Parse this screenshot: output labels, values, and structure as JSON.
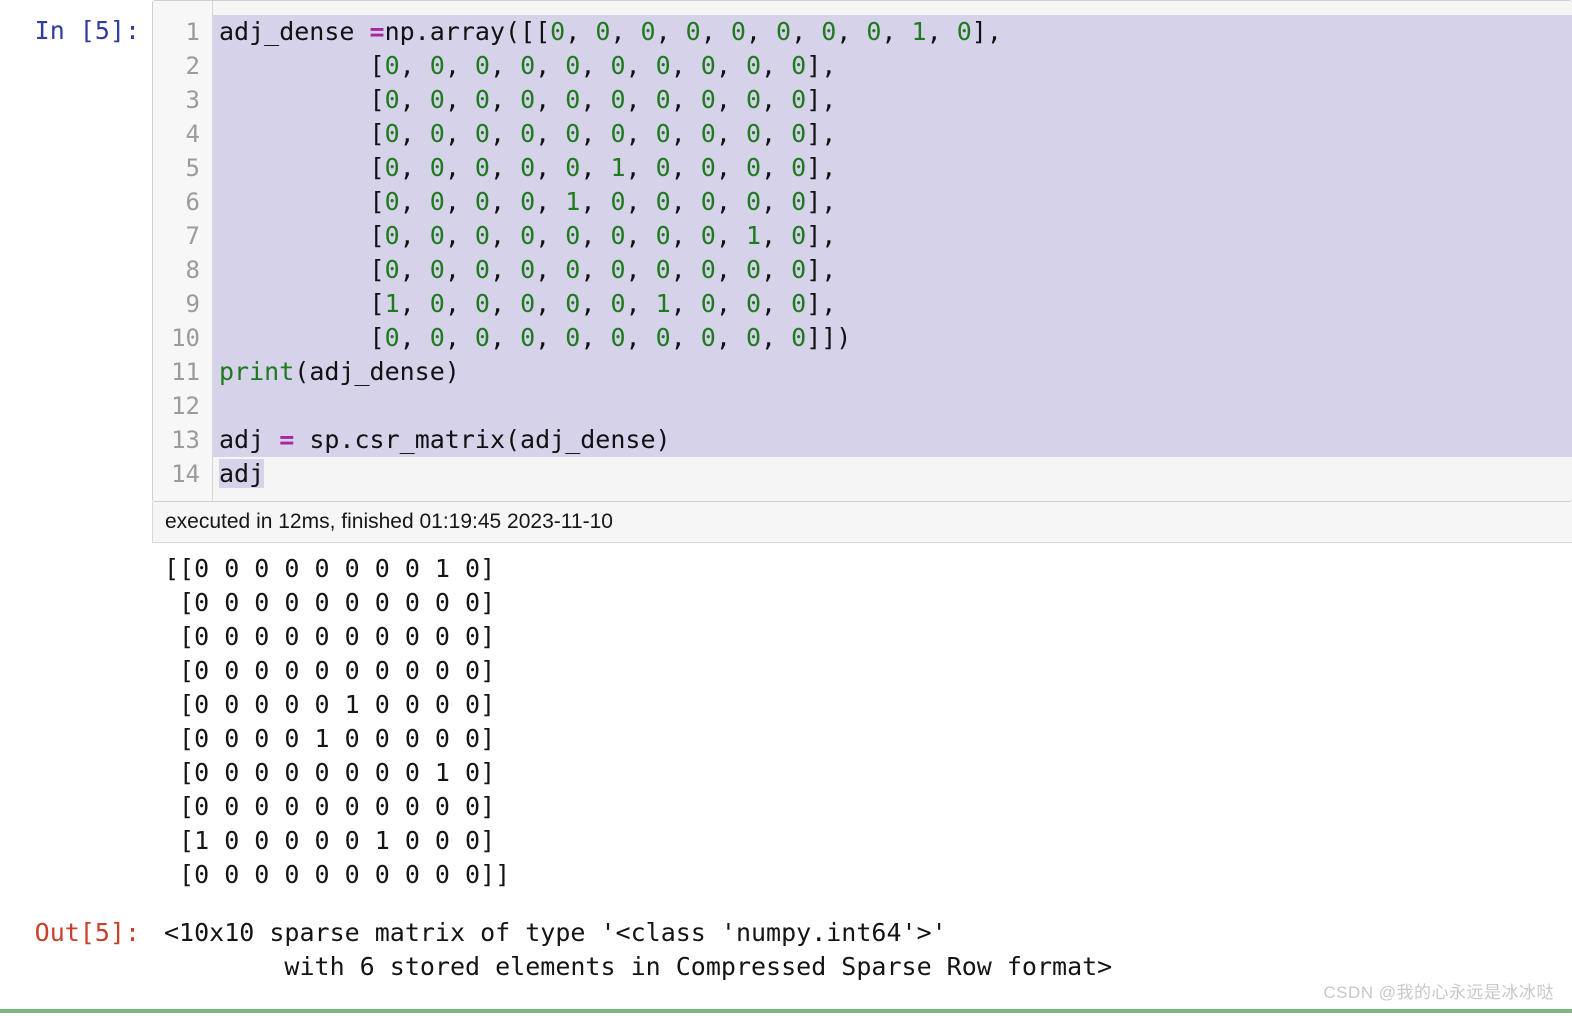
{
  "cell": {
    "in_prompt": "In [5]:",
    "out_prompt": "Out[5]:",
    "execution_info": "executed in 12ms, finished 01:19:45 2023-11-10",
    "line_numbers": [
      "1",
      "2",
      "3",
      "4",
      "5",
      "6",
      "7",
      "8",
      "9",
      "10",
      "11",
      "12",
      "13",
      "14"
    ],
    "code_lines": [
      {
        "n": 1,
        "selected": "full",
        "tokens": [
          {
            "t": "adj_dense ",
            "c": "pln"
          },
          {
            "t": "=",
            "c": "op"
          },
          {
            "t": "np.array([[",
            "c": "pln"
          },
          {
            "t": "0",
            "c": "num"
          },
          {
            "t": ", ",
            "c": "pln"
          },
          {
            "t": "0",
            "c": "num"
          },
          {
            "t": ", ",
            "c": "pln"
          },
          {
            "t": "0",
            "c": "num"
          },
          {
            "t": ", ",
            "c": "pln"
          },
          {
            "t": "0",
            "c": "num"
          },
          {
            "t": ", ",
            "c": "pln"
          },
          {
            "t": "0",
            "c": "num"
          },
          {
            "t": ", ",
            "c": "pln"
          },
          {
            "t": "0",
            "c": "num"
          },
          {
            "t": ", ",
            "c": "pln"
          },
          {
            "t": "0",
            "c": "num"
          },
          {
            "t": ", ",
            "c": "pln"
          },
          {
            "t": "0",
            "c": "num"
          },
          {
            "t": ", ",
            "c": "pln"
          },
          {
            "t": "1",
            "c": "num"
          },
          {
            "t": ", ",
            "c": "pln"
          },
          {
            "t": "0",
            "c": "num"
          },
          {
            "t": "],",
            "c": "pln"
          }
        ]
      },
      {
        "n": 2,
        "selected": "full",
        "tokens": [
          {
            "t": "          [",
            "c": "pln"
          },
          {
            "t": "0",
            "c": "num"
          },
          {
            "t": ", ",
            "c": "pln"
          },
          {
            "t": "0",
            "c": "num"
          },
          {
            "t": ", ",
            "c": "pln"
          },
          {
            "t": "0",
            "c": "num"
          },
          {
            "t": ", ",
            "c": "pln"
          },
          {
            "t": "0",
            "c": "num"
          },
          {
            "t": ", ",
            "c": "pln"
          },
          {
            "t": "0",
            "c": "num"
          },
          {
            "t": ", ",
            "c": "pln"
          },
          {
            "t": "0",
            "c": "num"
          },
          {
            "t": ", ",
            "c": "pln"
          },
          {
            "t": "0",
            "c": "num"
          },
          {
            "t": ", ",
            "c": "pln"
          },
          {
            "t": "0",
            "c": "num"
          },
          {
            "t": ", ",
            "c": "pln"
          },
          {
            "t": "0",
            "c": "num"
          },
          {
            "t": ", ",
            "c": "pln"
          },
          {
            "t": "0",
            "c": "num"
          },
          {
            "t": "],",
            "c": "pln"
          }
        ]
      },
      {
        "n": 3,
        "selected": "full",
        "tokens": [
          {
            "t": "          [",
            "c": "pln"
          },
          {
            "t": "0",
            "c": "num"
          },
          {
            "t": ", ",
            "c": "pln"
          },
          {
            "t": "0",
            "c": "num"
          },
          {
            "t": ", ",
            "c": "pln"
          },
          {
            "t": "0",
            "c": "num"
          },
          {
            "t": ", ",
            "c": "pln"
          },
          {
            "t": "0",
            "c": "num"
          },
          {
            "t": ", ",
            "c": "pln"
          },
          {
            "t": "0",
            "c": "num"
          },
          {
            "t": ", ",
            "c": "pln"
          },
          {
            "t": "0",
            "c": "num"
          },
          {
            "t": ", ",
            "c": "pln"
          },
          {
            "t": "0",
            "c": "num"
          },
          {
            "t": ", ",
            "c": "pln"
          },
          {
            "t": "0",
            "c": "num"
          },
          {
            "t": ", ",
            "c": "pln"
          },
          {
            "t": "0",
            "c": "num"
          },
          {
            "t": ", ",
            "c": "pln"
          },
          {
            "t": "0",
            "c": "num"
          },
          {
            "t": "],",
            "c": "pln"
          }
        ]
      },
      {
        "n": 4,
        "selected": "full",
        "tokens": [
          {
            "t": "          [",
            "c": "pln"
          },
          {
            "t": "0",
            "c": "num"
          },
          {
            "t": ", ",
            "c": "pln"
          },
          {
            "t": "0",
            "c": "num"
          },
          {
            "t": ", ",
            "c": "pln"
          },
          {
            "t": "0",
            "c": "num"
          },
          {
            "t": ", ",
            "c": "pln"
          },
          {
            "t": "0",
            "c": "num"
          },
          {
            "t": ", ",
            "c": "pln"
          },
          {
            "t": "0",
            "c": "num"
          },
          {
            "t": ", ",
            "c": "pln"
          },
          {
            "t": "0",
            "c": "num"
          },
          {
            "t": ", ",
            "c": "pln"
          },
          {
            "t": "0",
            "c": "num"
          },
          {
            "t": ", ",
            "c": "pln"
          },
          {
            "t": "0",
            "c": "num"
          },
          {
            "t": ", ",
            "c": "pln"
          },
          {
            "t": "0",
            "c": "num"
          },
          {
            "t": ", ",
            "c": "pln"
          },
          {
            "t": "0",
            "c": "num"
          },
          {
            "t": "],",
            "c": "pln"
          }
        ]
      },
      {
        "n": 5,
        "selected": "full",
        "tokens": [
          {
            "t": "          [",
            "c": "pln"
          },
          {
            "t": "0",
            "c": "num"
          },
          {
            "t": ", ",
            "c": "pln"
          },
          {
            "t": "0",
            "c": "num"
          },
          {
            "t": ", ",
            "c": "pln"
          },
          {
            "t": "0",
            "c": "num"
          },
          {
            "t": ", ",
            "c": "pln"
          },
          {
            "t": "0",
            "c": "num"
          },
          {
            "t": ", ",
            "c": "pln"
          },
          {
            "t": "0",
            "c": "num"
          },
          {
            "t": ", ",
            "c": "pln"
          },
          {
            "t": "1",
            "c": "num"
          },
          {
            "t": ", ",
            "c": "pln"
          },
          {
            "t": "0",
            "c": "num"
          },
          {
            "t": ", ",
            "c": "pln"
          },
          {
            "t": "0",
            "c": "num"
          },
          {
            "t": ", ",
            "c": "pln"
          },
          {
            "t": "0",
            "c": "num"
          },
          {
            "t": ", ",
            "c": "pln"
          },
          {
            "t": "0",
            "c": "num"
          },
          {
            "t": "],",
            "c": "pln"
          }
        ]
      },
      {
        "n": 6,
        "selected": "full",
        "tokens": [
          {
            "t": "          [",
            "c": "pln"
          },
          {
            "t": "0",
            "c": "num"
          },
          {
            "t": ", ",
            "c": "pln"
          },
          {
            "t": "0",
            "c": "num"
          },
          {
            "t": ", ",
            "c": "pln"
          },
          {
            "t": "0",
            "c": "num"
          },
          {
            "t": ", ",
            "c": "pln"
          },
          {
            "t": "0",
            "c": "num"
          },
          {
            "t": ", ",
            "c": "pln"
          },
          {
            "t": "1",
            "c": "num"
          },
          {
            "t": ", ",
            "c": "pln"
          },
          {
            "t": "0",
            "c": "num"
          },
          {
            "t": ", ",
            "c": "pln"
          },
          {
            "t": "0",
            "c": "num"
          },
          {
            "t": ", ",
            "c": "pln"
          },
          {
            "t": "0",
            "c": "num"
          },
          {
            "t": ", ",
            "c": "pln"
          },
          {
            "t": "0",
            "c": "num"
          },
          {
            "t": ", ",
            "c": "pln"
          },
          {
            "t": "0",
            "c": "num"
          },
          {
            "t": "],",
            "c": "pln"
          }
        ]
      },
      {
        "n": 7,
        "selected": "full",
        "tokens": [
          {
            "t": "          [",
            "c": "pln"
          },
          {
            "t": "0",
            "c": "num"
          },
          {
            "t": ", ",
            "c": "pln"
          },
          {
            "t": "0",
            "c": "num"
          },
          {
            "t": ", ",
            "c": "pln"
          },
          {
            "t": "0",
            "c": "num"
          },
          {
            "t": ", ",
            "c": "pln"
          },
          {
            "t": "0",
            "c": "num"
          },
          {
            "t": ", ",
            "c": "pln"
          },
          {
            "t": "0",
            "c": "num"
          },
          {
            "t": ", ",
            "c": "pln"
          },
          {
            "t": "0",
            "c": "num"
          },
          {
            "t": ", ",
            "c": "pln"
          },
          {
            "t": "0",
            "c": "num"
          },
          {
            "t": ", ",
            "c": "pln"
          },
          {
            "t": "0",
            "c": "num"
          },
          {
            "t": ", ",
            "c": "pln"
          },
          {
            "t": "1",
            "c": "num"
          },
          {
            "t": ", ",
            "c": "pln"
          },
          {
            "t": "0",
            "c": "num"
          },
          {
            "t": "],",
            "c": "pln"
          }
        ]
      },
      {
        "n": 8,
        "selected": "full",
        "tokens": [
          {
            "t": "          [",
            "c": "pln"
          },
          {
            "t": "0",
            "c": "num"
          },
          {
            "t": ", ",
            "c": "pln"
          },
          {
            "t": "0",
            "c": "num"
          },
          {
            "t": ", ",
            "c": "pln"
          },
          {
            "t": "0",
            "c": "num"
          },
          {
            "t": ", ",
            "c": "pln"
          },
          {
            "t": "0",
            "c": "num"
          },
          {
            "t": ", ",
            "c": "pln"
          },
          {
            "t": "0",
            "c": "num"
          },
          {
            "t": ", ",
            "c": "pln"
          },
          {
            "t": "0",
            "c": "num"
          },
          {
            "t": ", ",
            "c": "pln"
          },
          {
            "t": "0",
            "c": "num"
          },
          {
            "t": ", ",
            "c": "pln"
          },
          {
            "t": "0",
            "c": "num"
          },
          {
            "t": ", ",
            "c": "pln"
          },
          {
            "t": "0",
            "c": "num"
          },
          {
            "t": ", ",
            "c": "pln"
          },
          {
            "t": "0",
            "c": "num"
          },
          {
            "t": "],",
            "c": "pln"
          }
        ]
      },
      {
        "n": 9,
        "selected": "full",
        "tokens": [
          {
            "t": "          [",
            "c": "pln"
          },
          {
            "t": "1",
            "c": "num"
          },
          {
            "t": ", ",
            "c": "pln"
          },
          {
            "t": "0",
            "c": "num"
          },
          {
            "t": ", ",
            "c": "pln"
          },
          {
            "t": "0",
            "c": "num"
          },
          {
            "t": ", ",
            "c": "pln"
          },
          {
            "t": "0",
            "c": "num"
          },
          {
            "t": ", ",
            "c": "pln"
          },
          {
            "t": "0",
            "c": "num"
          },
          {
            "t": ", ",
            "c": "pln"
          },
          {
            "t": "0",
            "c": "num"
          },
          {
            "t": ", ",
            "c": "pln"
          },
          {
            "t": "1",
            "c": "num"
          },
          {
            "t": ", ",
            "c": "pln"
          },
          {
            "t": "0",
            "c": "num"
          },
          {
            "t": ", ",
            "c": "pln"
          },
          {
            "t": "0",
            "c": "num"
          },
          {
            "t": ", ",
            "c": "pln"
          },
          {
            "t": "0",
            "c": "num"
          },
          {
            "t": "],",
            "c": "pln"
          }
        ]
      },
      {
        "n": 10,
        "selected": "full",
        "tokens": [
          {
            "t": "          [",
            "c": "pln"
          },
          {
            "t": "0",
            "c": "num"
          },
          {
            "t": ", ",
            "c": "pln"
          },
          {
            "t": "0",
            "c": "num"
          },
          {
            "t": ", ",
            "c": "pln"
          },
          {
            "t": "0",
            "c": "num"
          },
          {
            "t": ", ",
            "c": "pln"
          },
          {
            "t": "0",
            "c": "num"
          },
          {
            "t": ", ",
            "c": "pln"
          },
          {
            "t": "0",
            "c": "num"
          },
          {
            "t": ", ",
            "c": "pln"
          },
          {
            "t": "0",
            "c": "num"
          },
          {
            "t": ", ",
            "c": "pln"
          },
          {
            "t": "0",
            "c": "num"
          },
          {
            "t": ", ",
            "c": "pln"
          },
          {
            "t": "0",
            "c": "num"
          },
          {
            "t": ", ",
            "c": "pln"
          },
          {
            "t": "0",
            "c": "num"
          },
          {
            "t": ", ",
            "c": "pln"
          },
          {
            "t": "0",
            "c": "num"
          },
          {
            "t": "]])",
            "c": "pln"
          }
        ]
      },
      {
        "n": 11,
        "selected": "full",
        "tokens": [
          {
            "t": "print",
            "c": "kw"
          },
          {
            "t": "(adj_dense)",
            "c": "pln"
          }
        ]
      },
      {
        "n": 12,
        "selected": "full",
        "tokens": [
          {
            "t": "",
            "c": "pln"
          }
        ]
      },
      {
        "n": 13,
        "selected": "full",
        "tokens": [
          {
            "t": "adj ",
            "c": "pln"
          },
          {
            "t": "=",
            "c": "op"
          },
          {
            "t": " sp.csr_matrix(adj_dense)",
            "c": "pln"
          }
        ]
      },
      {
        "n": 14,
        "selected": "partial",
        "tokens": [
          {
            "t": "adj",
            "c": "pln"
          }
        ]
      }
    ]
  },
  "stdout_lines": [
    "[[0 0 0 0 0 0 0 0 1 0]",
    " [0 0 0 0 0 0 0 0 0 0]",
    " [0 0 0 0 0 0 0 0 0 0]",
    " [0 0 0 0 0 0 0 0 0 0]",
    " [0 0 0 0 0 1 0 0 0 0]",
    " [0 0 0 0 1 0 0 0 0 0]",
    " [0 0 0 0 0 0 0 0 1 0]",
    " [0 0 0 0 0 0 0 0 0 0]",
    " [1 0 0 0 0 0 1 0 0 0]",
    " [0 0 0 0 0 0 0 0 0 0]]"
  ],
  "result_lines": [
    "<10x10 sparse matrix of type '<class 'numpy.int64'>'",
    "        with 6 stored elements in Compressed Sparse Row format>"
  ],
  "watermark": "CSDN @我的心永远是冰冰哒",
  "colors": {
    "in_prompt": "#303f9f",
    "out_prompt": "#c9402a",
    "selection": "#d5d2ea",
    "number_literal": "#1d7a1d",
    "operator": "#a626a4",
    "cell_background": "#f5f5f5",
    "gutter_text": "#9b9b9b",
    "bottom_rule": "#7db87d"
  },
  "matrix_data": {
    "variable": "adj_dense",
    "shape": [
      10,
      10
    ],
    "dtype": "numpy.int64",
    "stored_elements": 6,
    "format": "Compressed Sparse Row",
    "rows": [
      [
        0,
        0,
        0,
        0,
        0,
        0,
        0,
        0,
        1,
        0
      ],
      [
        0,
        0,
        0,
        0,
        0,
        0,
        0,
        0,
        0,
        0
      ],
      [
        0,
        0,
        0,
        0,
        0,
        0,
        0,
        0,
        0,
        0
      ],
      [
        0,
        0,
        0,
        0,
        0,
        0,
        0,
        0,
        0,
        0
      ],
      [
        0,
        0,
        0,
        0,
        0,
        1,
        0,
        0,
        0,
        0
      ],
      [
        0,
        0,
        0,
        0,
        1,
        0,
        0,
        0,
        0,
        0
      ],
      [
        0,
        0,
        0,
        0,
        0,
        0,
        0,
        0,
        1,
        0
      ],
      [
        0,
        0,
        0,
        0,
        0,
        0,
        0,
        0,
        0,
        0
      ],
      [
        1,
        0,
        0,
        0,
        0,
        0,
        1,
        0,
        0,
        0
      ],
      [
        0,
        0,
        0,
        0,
        0,
        0,
        0,
        0,
        0,
        0
      ]
    ]
  }
}
